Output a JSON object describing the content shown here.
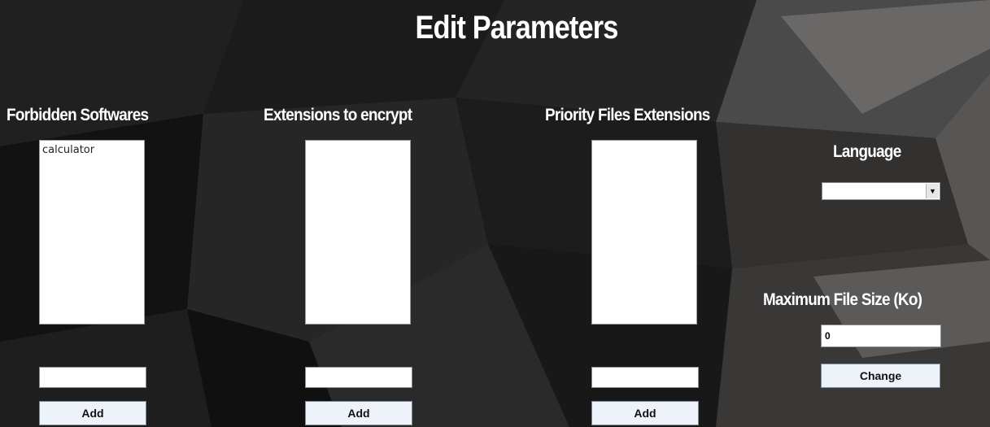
{
  "title": "Edit Parameters",
  "columns": [
    {
      "heading": "Forbidden Softwares",
      "items": [
        "calculator"
      ],
      "input_value": "",
      "add_label": "Add"
    },
    {
      "heading": "Extensions to encrypt",
      "items": [],
      "input_value": "",
      "add_label": "Add"
    },
    {
      "heading": "Priority Files Extensions",
      "items": [],
      "input_value": "",
      "add_label": "Add"
    }
  ],
  "language": {
    "label": "Language",
    "selected": ""
  },
  "max_size": {
    "label": "Maximum File Size (Ko)",
    "value": "0",
    "change_label": "Change"
  },
  "icons": {
    "dropdown": "chevron-down-icon"
  },
  "colors": {
    "background": "#141414",
    "text": "#ffffff",
    "button": "#eef3fa"
  }
}
